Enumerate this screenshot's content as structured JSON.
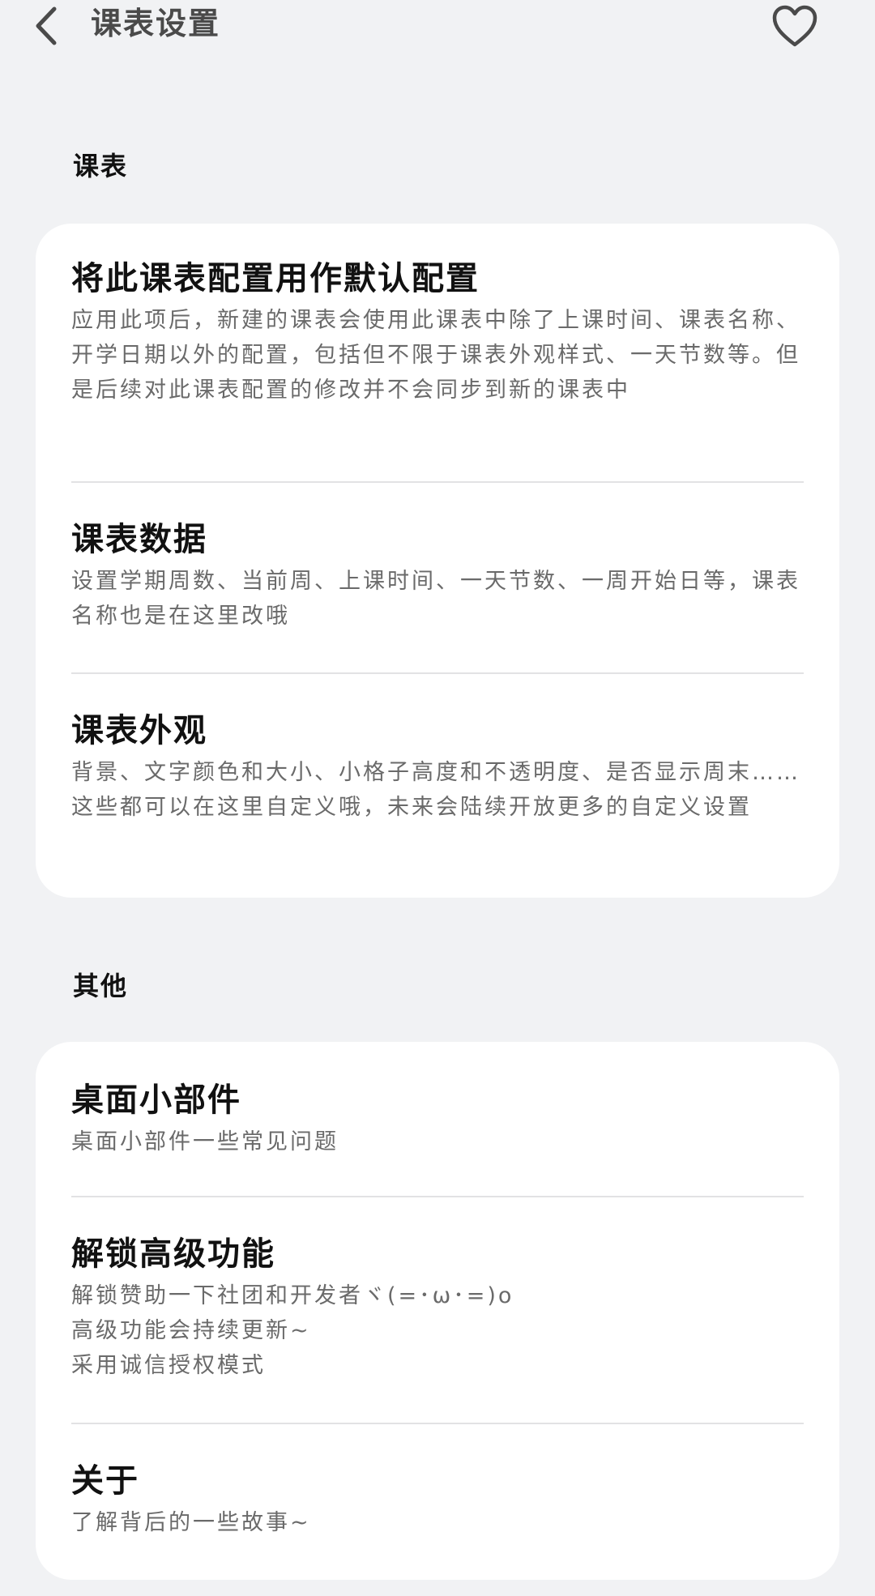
{
  "header": {
    "title": "课表设置",
    "back_icon": "chevron-left-icon",
    "favorite_icon": "heart-outline-icon"
  },
  "sections": [
    {
      "label": "课表",
      "items": [
        {
          "title": "将此课表配置用作默认配置",
          "desc": "应用此项后，新建的课表会使用此课表中除了上课时间、课表名称、开学日期以外的配置，包括但不限于课表外观样式、一天节数等。但是后续对此课表配置的修改并不会同步到新的课表中"
        },
        {
          "title": "课表数据",
          "desc": "设置学期周数、当前周、上课时间、一天节数、一周开始日等，课表名称也是在这里改哦"
        },
        {
          "title": "课表外观",
          "desc": "背景、文字颜色和大小、小格子高度和不透明度、是否显示周末……这些都可以在这里自定义哦，未来会陆续开放更多的自定义设置"
        }
      ]
    },
    {
      "label": "其他",
      "items": [
        {
          "title": "桌面小部件",
          "desc": "桌面小部件一些常见问题"
        },
        {
          "title": "解锁高级功能",
          "desc": "解锁赞助一下社团和开发者ヾ(=･ω･=)o\n高级功能会持续更新~\n采用诚信授权模式"
        },
        {
          "title": "关于",
          "desc": "了解背后的一些故事~"
        }
      ]
    }
  ],
  "colors": {
    "background": "#f1f2f4",
    "card": "#ffffff",
    "title_text": "#111111",
    "desc_text": "#6a6a6a",
    "divider": "#e2e2e4"
  }
}
